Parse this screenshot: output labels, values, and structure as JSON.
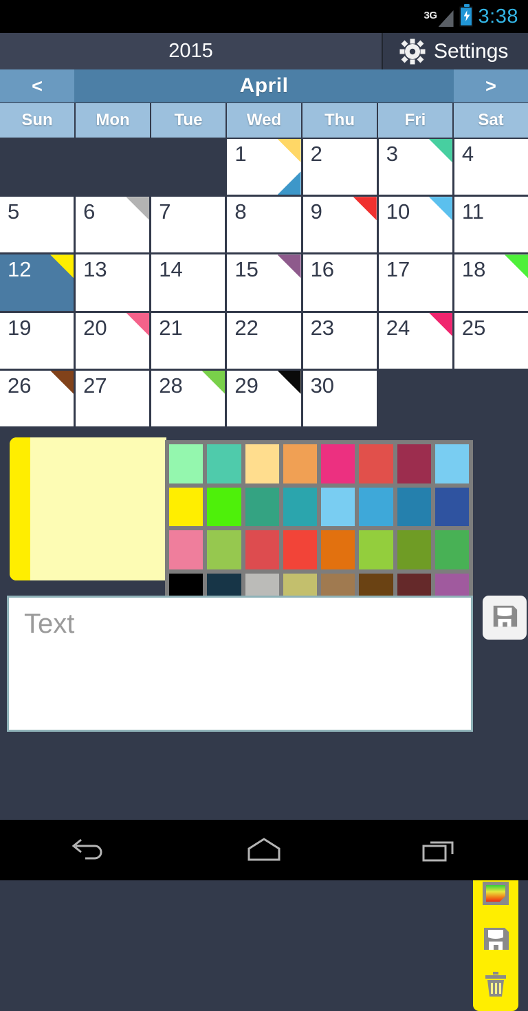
{
  "status_bar": {
    "network_label": "3G",
    "time": "3:38",
    "battery_icon": "battery-charging-icon",
    "signal_icon": "signal-triangle-icon",
    "time_color": "#33b5e5"
  },
  "title_bar": {
    "year": "2015",
    "settings_label": "Settings",
    "settings_icon": "gear-icon"
  },
  "month_nav": {
    "prev_label": "<",
    "next_label": ">",
    "month": "April"
  },
  "weekdays": [
    "Sun",
    "Mon",
    "Tue",
    "Wed",
    "Thu",
    "Fri",
    "Sat"
  ],
  "calendar": {
    "leading_blanks": 3,
    "selected_day": 12,
    "days": [
      {
        "num": "1",
        "corner_tr": "#ffd766",
        "corner_br": "#3d97c9"
      },
      {
        "num": "2",
        "corner_tr": null,
        "corner_br": null
      },
      {
        "num": "3",
        "corner_tr": "#47cfa0",
        "corner_br": null
      },
      {
        "num": "4",
        "corner_tr": null,
        "corner_br": null
      },
      {
        "num": "5",
        "corner_tr": null,
        "corner_br": null
      },
      {
        "num": "6",
        "corner_tr": "#b3b3b3",
        "corner_br": null
      },
      {
        "num": "7",
        "corner_tr": null,
        "corner_br": null
      },
      {
        "num": "8",
        "corner_tr": null,
        "corner_br": null
      },
      {
        "num": "9",
        "corner_tr": "#f0312f",
        "corner_br": null
      },
      {
        "num": "10",
        "corner_tr": "#5bc0ee",
        "corner_br": null
      },
      {
        "num": "11",
        "corner_tr": null,
        "corner_br": null
      },
      {
        "num": "12",
        "corner_tr": "#ffee00",
        "corner_br": null
      },
      {
        "num": "13",
        "corner_tr": null,
        "corner_br": null
      },
      {
        "num": "14",
        "corner_tr": null,
        "corner_br": null
      },
      {
        "num": "15",
        "corner_tr": "#8e5a8c",
        "corner_br": null
      },
      {
        "num": "16",
        "corner_tr": null,
        "corner_br": null
      },
      {
        "num": "17",
        "corner_tr": null,
        "corner_br": null
      },
      {
        "num": "18",
        "corner_tr": "#4ef03a",
        "corner_br": null
      },
      {
        "num": "19",
        "corner_tr": null,
        "corner_br": null
      },
      {
        "num": "20",
        "corner_tr": "#f4628a",
        "corner_br": null
      },
      {
        "num": "21",
        "corner_tr": null,
        "corner_br": null
      },
      {
        "num": "22",
        "corner_tr": null,
        "corner_br": null
      },
      {
        "num": "23",
        "corner_tr": null,
        "corner_br": null
      },
      {
        "num": "24",
        "corner_tr": "#f0256e",
        "corner_br": null
      },
      {
        "num": "25",
        "corner_tr": null,
        "corner_br": null
      },
      {
        "num": "26",
        "corner_tr": "#81421a",
        "corner_br": null
      },
      {
        "num": "27",
        "corner_tr": null,
        "corner_br": null
      },
      {
        "num": "28",
        "corner_tr": "#79d04a",
        "corner_br": null
      },
      {
        "num": "29",
        "corner_tr": "#0a0a0a",
        "corner_br": null
      },
      {
        "num": "30",
        "corner_tr": null,
        "corner_br": null
      }
    ]
  },
  "palette": {
    "preview_body_color": "#fdfcb4",
    "preview_strip_color": "#ffee00",
    "swatches": [
      "#94f7ae",
      "#4fcbab",
      "#ffdd8e",
      "#f0a054",
      "#ec3080",
      "#e1504b",
      "#9c2d4e",
      "#79cdf2",
      "#ffee00",
      "#4ef00a",
      "#34a382",
      "#2ba5ad",
      "#79cdf2",
      "#3ea8d9",
      "#2580ad",
      "#2f53a0",
      "#ef7e9c",
      "#96c84f",
      "#dd4c4f",
      "#f24438",
      "#e2710f",
      "#93ce3d",
      "#6f9c25",
      "#48b155",
      "#000000",
      "#173547",
      "#bbbbb8",
      "#c3bf6d",
      "#a07a50",
      "#6a4213",
      "#65292a",
      "#a05a9e"
    ],
    "tools": [
      {
        "name": "color-picker-icon",
        "label": "color-picker"
      },
      {
        "name": "save-icon",
        "label": "save"
      },
      {
        "name": "trash-icon",
        "label": "delete"
      }
    ],
    "tool_bg_color": "#ffee00"
  },
  "text_entry": {
    "placeholder": "Text",
    "value": "",
    "save_icon": "save-icon"
  },
  "nav_bar": {
    "back_label": "back-icon",
    "home_label": "home-icon",
    "recents_label": "recents-icon"
  }
}
